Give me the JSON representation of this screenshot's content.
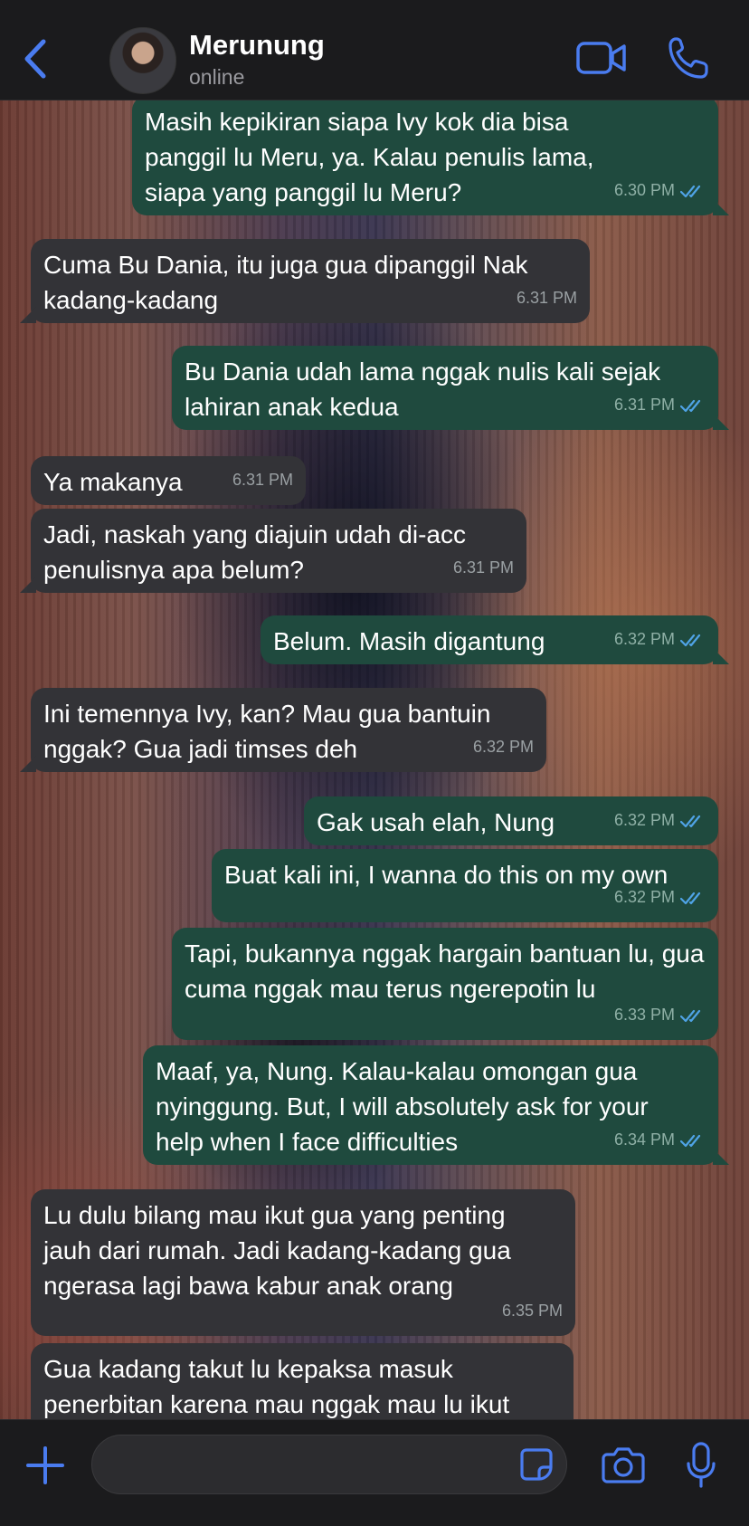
{
  "header": {
    "contact_name": "Merunung",
    "contact_status": "online"
  },
  "messages": [
    {
      "direction": "out",
      "text": "Masih kepikiran siapa Ivy kok dia bisa panggil lu Meru, ya. Kalau penulis lama, siapa yang panggil lu Meru?",
      "time": "6.30 PM",
      "read": true
    },
    {
      "direction": "in",
      "text": "Cuma Bu Dania, itu juga gua dipanggil Nak kadang-kadang",
      "time": "6.31 PM"
    },
    {
      "direction": "out",
      "text": "Bu Dania udah lama nggak nulis kali sejak lahiran anak kedua",
      "time": "6.31 PM",
      "read": true
    },
    {
      "direction": "in",
      "text": "Ya makanya",
      "time": "6.31 PM"
    },
    {
      "direction": "in",
      "text": "Jadi, naskah yang diajuin udah di-acc penulisnya apa belum?",
      "time": "6.31 PM"
    },
    {
      "direction": "out",
      "text": "Belum. Masih digantung",
      "time": "6.32 PM",
      "read": true
    },
    {
      "direction": "in",
      "text": "Ini temennya Ivy, kan? Mau gua bantuin nggak? Gua jadi timses deh",
      "time": "6.32 PM"
    },
    {
      "direction": "out",
      "text": "Gak usah elah, Nung",
      "time": "6.32 PM",
      "read": true
    },
    {
      "direction": "out",
      "text": "Buat kali ini, I wanna do this on my own",
      "time": "6.32 PM",
      "read": true
    },
    {
      "direction": "out",
      "text": "Tapi, bukannya nggak hargain bantuan lu, gua cuma nggak mau terus ngerepotin lu",
      "time": "6.33 PM",
      "read": true
    },
    {
      "direction": "out",
      "text": "Maaf, ya, Nung. Kalau-kalau omongan gua nyinggung. But, I will absolutely ask for your help when I face difficulties",
      "time": "6.34 PM",
      "read": true
    },
    {
      "direction": "in",
      "text": "Lu dulu bilang mau ikut gua yang penting jauh dari rumah. Jadi kadang-kadang gua ngerasa lagi bawa kabur anak orang",
      "time": "6.35 PM"
    },
    {
      "direction": "in",
      "text": "Gua kadang takut lu kepaksa masuk penerbitan karena mau nggak mau lu ikut",
      "time": ""
    }
  ],
  "composer": {
    "placeholder": ""
  },
  "colors": {
    "accent": "#4a7cf0",
    "incoming_bubble": "#333337",
    "outgoing_bubble": "#1f4a3e",
    "read_ticks": "#4fa3e6"
  }
}
